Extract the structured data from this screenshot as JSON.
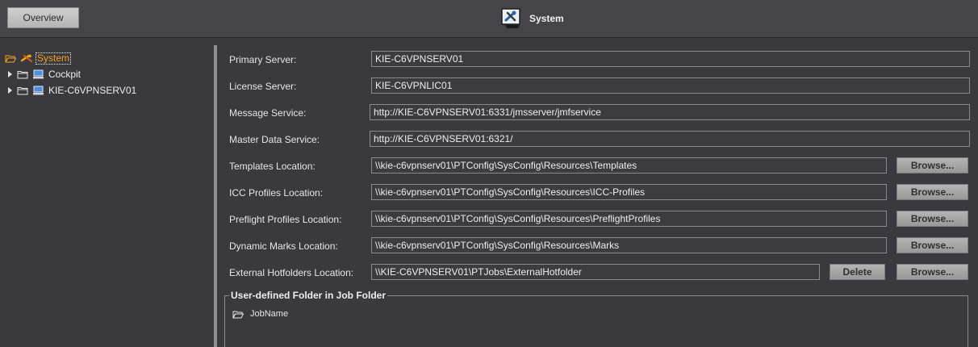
{
  "header": {
    "overview_label": "Overview",
    "title": "System"
  },
  "tree": {
    "root": {
      "label": "System",
      "icon": "system-icon"
    },
    "items": [
      {
        "label": "Cockpit",
        "icon": "computer-icon"
      },
      {
        "label": "KIE-C6VPNSERV01",
        "icon": "computer-icon"
      }
    ]
  },
  "form": {
    "primary_server": {
      "label": "Primary Server:",
      "value": "KIE-C6VPNSERV01"
    },
    "license_server": {
      "label": "License Server:",
      "value": "KIE-C6VPNLIC01"
    },
    "message_service": {
      "label": "Message Service:",
      "value": "http://KIE-C6VPNSERV01:6331/jmsserver/jmfservice"
    },
    "master_data_service": {
      "label": "Master Data Service:",
      "value": "http://KIE-C6VPNSERV01:6321/"
    },
    "templates_location": {
      "label": "Templates Location:",
      "value": "\\\\kie-c6vpnserv01\\PTConfig\\SysConfig\\Resources\\Templates"
    },
    "icc_profiles_location": {
      "label": "ICC Profiles Location:",
      "value": "\\\\kie-c6vpnserv01\\PTConfig\\SysConfig\\Resources\\ICC-Profiles"
    },
    "preflight_profiles_location": {
      "label": "Preflight Profiles Location:",
      "value": "\\\\kie-c6vpnserv01\\PTConfig\\SysConfig\\Resources\\PreflightProfiles"
    },
    "dynamic_marks_location": {
      "label": "Dynamic Marks Location:",
      "value": "\\\\kie-c6vpnserv01\\PTConfig\\SysConfig\\Resources\\Marks"
    },
    "external_hotfolders_location": {
      "label": "External Hotfolders Location:",
      "value": "\\\\KIE-C6VPNSERV01\\PTJobs\\ExternalHotfolder"
    },
    "browse_label": "Browse...",
    "delete_label": "Delete"
  },
  "user_folder_group": {
    "title": "User-defined Folder in Job Folder",
    "item": "JobName"
  },
  "colors": {
    "background": "#3a3a3e",
    "selected_text": "#f7a020"
  }
}
